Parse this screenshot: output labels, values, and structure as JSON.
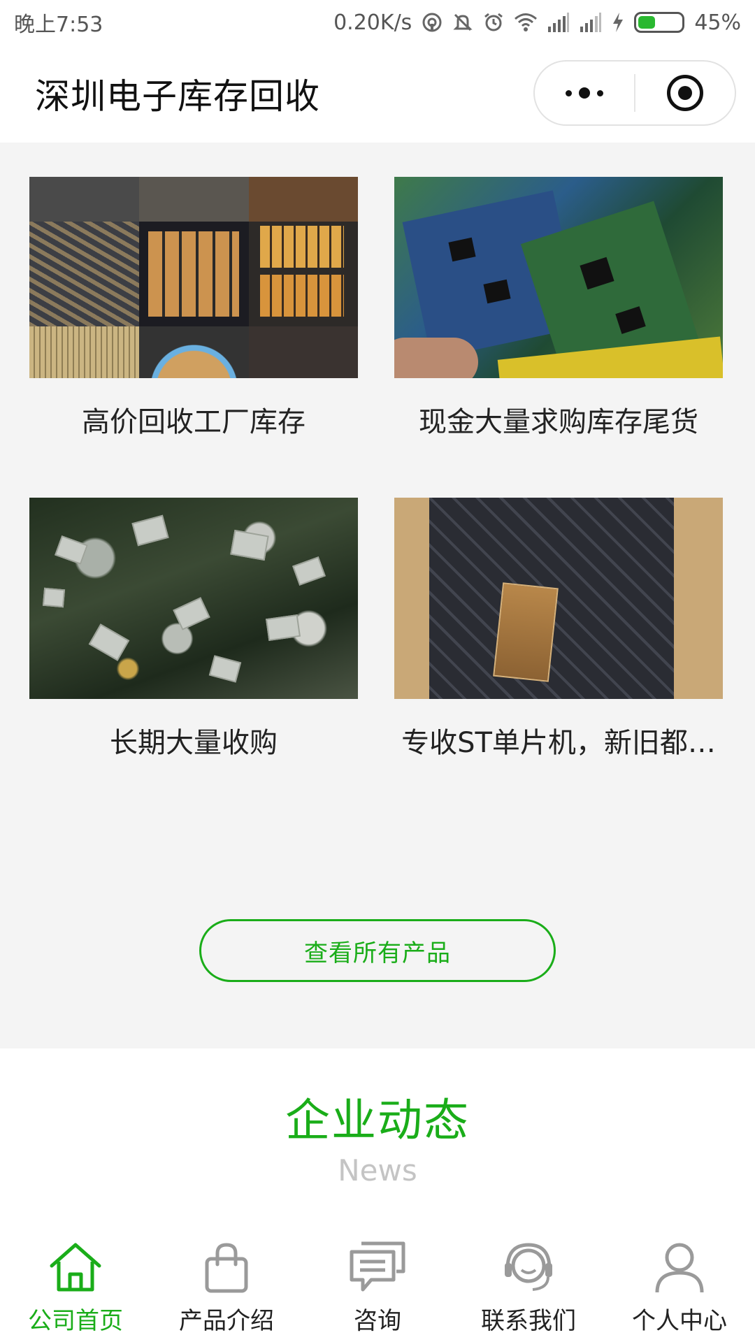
{
  "status_bar": {
    "time": "晚上7:53",
    "net_speed": "0.20K/s",
    "battery": "45%",
    "battery_level": 0.45
  },
  "nav": {
    "title": "深圳电子库存回收"
  },
  "products": [
    {
      "name": "高价回收工厂库存"
    },
    {
      "name": "现金大量求购库存尾货"
    },
    {
      "name": "长期大量收购"
    },
    {
      "name": "专收ST单片机，新旧都…"
    }
  ],
  "view_all_label": "查看所有产品",
  "news": {
    "title": "企业动态",
    "subtitle": "News"
  },
  "tabs": [
    {
      "label": "公司首页",
      "icon": "home-icon",
      "active": true
    },
    {
      "label": "产品介绍",
      "icon": "bag-icon",
      "active": false
    },
    {
      "label": "咨询",
      "icon": "chat-icon",
      "active": false
    },
    {
      "label": "联系我们",
      "icon": "headset-icon",
      "active": false
    },
    {
      "label": "个人中心",
      "icon": "user-icon",
      "active": false
    }
  ],
  "colors": {
    "accent": "#1aad19",
    "tab_inactive": "#9a9a9a",
    "page_bg": "#f4f4f4"
  }
}
